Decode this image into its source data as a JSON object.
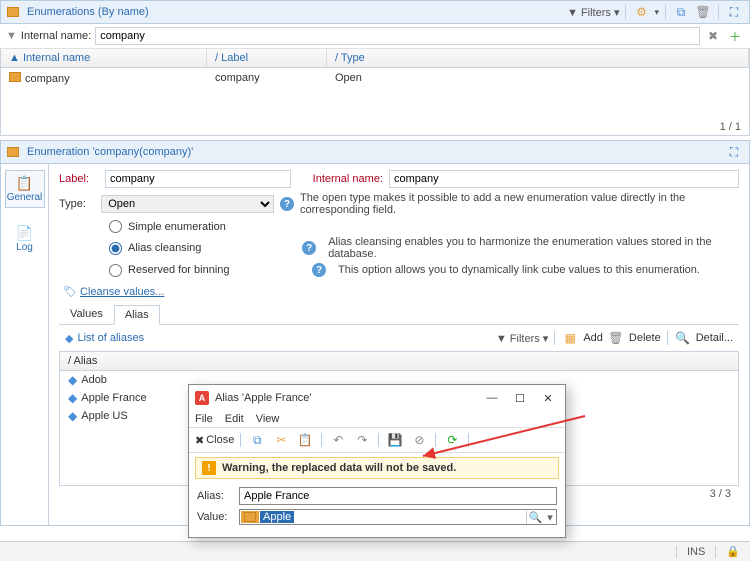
{
  "top": {
    "title": "Enumerations (By name)",
    "filters_label": "Filters",
    "filter_field_label": "Internal name:",
    "filter_value": "company"
  },
  "columns": {
    "internal_name": "Internal name",
    "label": "Label",
    "type": "Type"
  },
  "row": {
    "internal_name": "company",
    "label": "company",
    "type": "Open"
  },
  "page_count": "1 / 1",
  "detail": {
    "title": "Enumeration 'company(company)'",
    "tabs": {
      "general": "General",
      "log": "Log"
    },
    "label_lbl": "Label:",
    "label_val": "company",
    "internal_lbl": "Internal name:",
    "internal_val": "company",
    "type_lbl": "Type:",
    "type_val": "Open",
    "type_help": "The open type makes it possible to add a new enumeration value directly in the corresponding field.",
    "opt_simple": "Simple enumeration",
    "opt_alias": "Alias cleansing",
    "alias_help": "Alias cleansing enables you to harmonize the enumeration values stored in the database.",
    "opt_reserved": "Reserved for binning",
    "reserved_help": "This option allows you to dynamically link cube values to this enumeration.",
    "cleanse_link": "Cleanse values...",
    "inner_tabs": {
      "values": "Values",
      "alias": "Alias"
    }
  },
  "aliases": {
    "title": "List of aliases",
    "filters": "Filters",
    "add": "Add",
    "delete": "Delete",
    "detail": "Detail...",
    "col_alias": "Alias",
    "items": [
      "Adob",
      "Apple France",
      "Apple US"
    ],
    "page": "3 / 3"
  },
  "dialog": {
    "title": "Alias 'Apple France'",
    "menu": {
      "file": "File",
      "edit": "Edit",
      "view": "View"
    },
    "close": "Close",
    "warning": "Warning, the replaced data will not be saved.",
    "alias_lbl": "Alias:",
    "alias_val": "Apple France",
    "value_lbl": "Value:",
    "value_val": "Apple"
  },
  "statusbar": {
    "ins": "INS"
  }
}
